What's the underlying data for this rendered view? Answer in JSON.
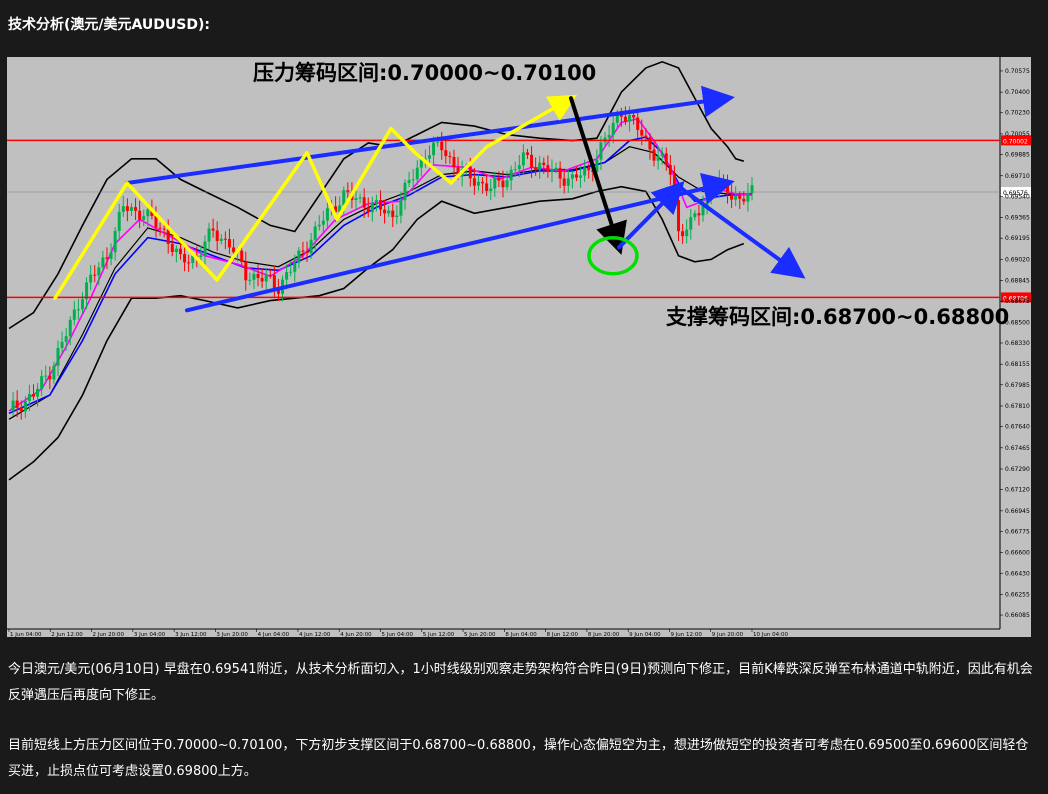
{
  "heading": "技术分析(澳元/美元AUDUSD):",
  "paragraphs": [
    "今日澳元/美元(06月10日) 早盘在0.69541附近，从技术分析面切入，1小时线级别观察走势架构符合昨日(9日)预测向下修正，目前K棒跌深反弹至布林通道中轨附近，因此有机会反弹遇压后再度向下修正。",
    "目前短线上方压力区间位于0.70000~0.70100，下方初步支撑区间于0.68700~0.68800，操作心态偏短空为主，想进场做短空的投资者可考虑在0.69500至0.69600区间轻仓买进，止损点位可考虑设置0.69800上方。"
  ],
  "chart_data": {
    "type": "candlestick",
    "title": "",
    "annotations": {
      "resistance": "压力筹码区间:0.70000~0.70100",
      "support": "支撑筹码区间:0.68700~0.68800"
    },
    "ylim": [
      0.6597,
      0.7069
    ],
    "y_ticks": [
      "0.70575",
      "0.70400",
      "0.70230",
      "0.70055",
      "0.69885",
      "0.69710",
      "0.69540",
      "0.69365",
      "0.69195",
      "0.69020",
      "0.68845",
      "0.68675",
      "0.68500",
      "0.68330",
      "0.68155",
      "0.67985",
      "0.67810",
      "0.67640",
      "0.67465",
      "0.67290",
      "0.67120",
      "0.66945",
      "0.66775",
      "0.66600",
      "0.66430",
      "0.66255",
      "0.66085"
    ],
    "x_ticks": [
      "1 Jun 04:00",
      "2 Jun 12:00",
      "2 Jun 20:00",
      "3 Jun 04:00",
      "3 Jun 12:00",
      "3 Jun 20:00",
      "4 Jun 04:00",
      "4 Jun 12:00",
      "4 Jun 20:00",
      "5 Jun 04:00",
      "5 Jun 12:00",
      "5 Jun 20:00",
      "8 Jun 04:00",
      "8 Jun 12:00",
      "8 Jun 20:00",
      "9 Jun 04:00",
      "9 Jun 12:00",
      "9 Jun 20:00",
      "10 Jun 04:00"
    ],
    "horizontal_lines": [
      {
        "value": 0.70002,
        "label": "0.70002",
        "color": "#ff0000"
      },
      {
        "value": 0.68706,
        "label": "0.68706",
        "color": "#ff0000"
      }
    ],
    "current_price": {
      "value": 0.69576,
      "label": "0.69576"
    },
    "colors": {
      "up": "#00b050",
      "down": "#ff0000",
      "ma_fast": "#ff00ff",
      "ma_slow": "#0000ff",
      "bands": "#000000",
      "channel": "#1a2cff",
      "zigzag": "#ffff00",
      "highlight": "#00e000"
    },
    "close_path": [
      [
        0,
        0.6777
      ],
      [
        6,
        0.679
      ],
      [
        10,
        0.681
      ],
      [
        14,
        0.684
      ],
      [
        18,
        0.6875
      ],
      [
        24,
        0.6905
      ],
      [
        28,
        0.6945
      ],
      [
        33,
        0.694
      ],
      [
        38,
        0.6925
      ],
      [
        42,
        0.69
      ],
      [
        46,
        0.6905
      ],
      [
        50,
        0.6925
      ],
      [
        54,
        0.6915
      ],
      [
        58,
        0.689
      ],
      [
        63,
        0.6885
      ],
      [
        66,
        0.688
      ],
      [
        70,
        0.6898
      ],
      [
        74,
        0.692
      ],
      [
        78,
        0.694
      ],
      [
        82,
        0.6955
      ],
      [
        86,
        0.695
      ],
      [
        90,
        0.6945
      ],
      [
        94,
        0.6938
      ],
      [
        98,
        0.6965
      ],
      [
        102,
        0.699
      ],
      [
        106,
        0.6995
      ],
      [
        110,
        0.6975
      ],
      [
        114,
        0.6968
      ],
      [
        118,
        0.696
      ],
      [
        122,
        0.697
      ],
      [
        126,
        0.6985
      ],
      [
        130,
        0.698
      ],
      [
        134,
        0.6972
      ],
      [
        138,
        0.6968
      ],
      [
        142,
        0.6975
      ],
      [
        146,
        0.7
      ],
      [
        150,
        0.7025
      ],
      [
        154,
        0.701
      ],
      [
        158,
        0.699
      ],
      [
        162,
        0.6975
      ],
      [
        164,
        0.6925
      ],
      [
        167,
        0.693
      ],
      [
        170,
        0.6948
      ],
      [
        173,
        0.6965
      ],
      [
        176,
        0.6958
      ],
      [
        179,
        0.6952
      ],
      [
        182,
        0.6956
      ]
    ],
    "ma_fast": [
      [
        0,
        0.6777
      ],
      [
        8,
        0.6795
      ],
      [
        14,
        0.683
      ],
      [
        20,
        0.687
      ],
      [
        26,
        0.6915
      ],
      [
        32,
        0.6935
      ],
      [
        40,
        0.692
      ],
      [
        48,
        0.6905
      ],
      [
        56,
        0.6898
      ],
      [
        64,
        0.6888
      ],
      [
        72,
        0.6905
      ],
      [
        80,
        0.6935
      ],
      [
        88,
        0.6948
      ],
      [
        96,
        0.695
      ],
      [
        104,
        0.698
      ],
      [
        112,
        0.6978
      ],
      [
        120,
        0.6968
      ],
      [
        128,
        0.6978
      ],
      [
        136,
        0.6975
      ],
      [
        144,
        0.6985
      ],
      [
        150,
        0.7015
      ],
      [
        154,
        0.7018
      ],
      [
        158,
        0.7
      ],
      [
        162,
        0.6978
      ],
      [
        166,
        0.6945
      ],
      [
        170,
        0.695
      ],
      [
        174,
        0.696
      ],
      [
        178,
        0.6956
      ],
      [
        182,
        0.6955
      ]
    ],
    "ma_slow": [
      [
        0,
        0.6775
      ],
      [
        10,
        0.679
      ],
      [
        18,
        0.6835
      ],
      [
        26,
        0.689
      ],
      [
        34,
        0.692
      ],
      [
        42,
        0.6915
      ],
      [
        50,
        0.6905
      ],
      [
        58,
        0.6895
      ],
      [
        66,
        0.6893
      ],
      [
        74,
        0.6905
      ],
      [
        82,
        0.693
      ],
      [
        90,
        0.6945
      ],
      [
        98,
        0.6955
      ],
      [
        106,
        0.697
      ],
      [
        114,
        0.6972
      ],
      [
        122,
        0.697
      ],
      [
        130,
        0.6975
      ],
      [
        138,
        0.6975
      ],
      [
        146,
        0.6982
      ],
      [
        152,
        0.7
      ],
      [
        156,
        0.7003
      ],
      [
        160,
        0.699
      ],
      [
        164,
        0.6965
      ],
      [
        168,
        0.695
      ],
      [
        172,
        0.6953
      ],
      [
        176,
        0.6955
      ],
      [
        182,
        0.6956
      ]
    ],
    "bb_upper": [
      [
        0,
        0.6845
      ],
      [
        6,
        0.6858
      ],
      [
        12,
        0.689
      ],
      [
        18,
        0.693
      ],
      [
        24,
        0.6968
      ],
      [
        30,
        0.6985
      ],
      [
        36,
        0.6985
      ],
      [
        42,
        0.6968
      ],
      [
        48,
        0.6958
      ],
      [
        56,
        0.6945
      ],
      [
        64,
        0.693
      ],
      [
        70,
        0.6925
      ],
      [
        76,
        0.6955
      ],
      [
        82,
        0.6985
      ],
      [
        88,
        0.6998
      ],
      [
        94,
        0.6995
      ],
      [
        100,
        0.7005
      ],
      [
        106,
        0.7015
      ],
      [
        114,
        0.7012
      ],
      [
        122,
        0.7005
      ],
      [
        130,
        0.7002
      ],
      [
        138,
        0.7
      ],
      [
        144,
        0.7002
      ],
      [
        150,
        0.704
      ],
      [
        156,
        0.706
      ],
      [
        160,
        0.7065
      ],
      [
        164,
        0.706
      ],
      [
        168,
        0.7035
      ],
      [
        172,
        0.701
      ],
      [
        176,
        0.6995
      ],
      [
        178,
        0.6985
      ],
      [
        180,
        0.6983
      ]
    ],
    "bb_lower": [
      [
        0,
        0.672
      ],
      [
        6,
        0.6735
      ],
      [
        12,
        0.6755
      ],
      [
        18,
        0.679
      ],
      [
        24,
        0.6835
      ],
      [
        30,
        0.687
      ],
      [
        36,
        0.687
      ],
      [
        42,
        0.6872
      ],
      [
        48,
        0.6868
      ],
      [
        56,
        0.6862
      ],
      [
        64,
        0.6868
      ],
      [
        70,
        0.687
      ],
      [
        76,
        0.6872
      ],
      [
        82,
        0.6878
      ],
      [
        88,
        0.6895
      ],
      [
        94,
        0.691
      ],
      [
        100,
        0.6935
      ],
      [
        106,
        0.695
      ],
      [
        114,
        0.694
      ],
      [
        122,
        0.6945
      ],
      [
        130,
        0.695
      ],
      [
        138,
        0.6952
      ],
      [
        144,
        0.6958
      ],
      [
        150,
        0.6962
      ],
      [
        156,
        0.6958
      ],
      [
        160,
        0.6935
      ],
      [
        164,
        0.6905
      ],
      [
        168,
        0.69
      ],
      [
        172,
        0.6902
      ],
      [
        176,
        0.691
      ],
      [
        180,
        0.6915
      ]
    ],
    "bb_middle": [
      [
        0,
        0.677
      ],
      [
        10,
        0.679
      ],
      [
        18,
        0.684
      ],
      [
        26,
        0.6895
      ],
      [
        34,
        0.6928
      ],
      [
        42,
        0.692
      ],
      [
        50,
        0.6908
      ],
      [
        58,
        0.69
      ],
      [
        66,
        0.6896
      ],
      [
        74,
        0.691
      ],
      [
        82,
        0.6935
      ],
      [
        90,
        0.6948
      ],
      [
        98,
        0.6958
      ],
      [
        106,
        0.6972
      ],
      [
        114,
        0.6975
      ],
      [
        122,
        0.6972
      ],
      [
        130,
        0.6976
      ],
      [
        138,
        0.6976
      ],
      [
        146,
        0.6982
      ],
      [
        152,
        0.6995
      ],
      [
        158,
        0.699
      ],
      [
        164,
        0.697
      ],
      [
        170,
        0.6958
      ],
      [
        176,
        0.6956
      ],
      [
        180,
        0.6956
      ]
    ],
    "channel_upper": [
      [
        0.2,
        0.6965
      ],
      [
        1.2,
        0.7035
      ]
    ],
    "channel_lower": [
      [
        0.3,
        0.686
      ],
      [
        1.2,
        0.6965
      ]
    ],
    "zigzag": [
      [
        0.08,
        0.687
      ],
      [
        0.2,
        0.6965
      ],
      [
        0.35,
        0.6885
      ],
      [
        0.5,
        0.699
      ],
      [
        0.55,
        0.6935
      ],
      [
        0.64,
        0.701
      ],
      [
        0.68,
        0.699
      ],
      [
        0.74,
        0.6965
      ],
      [
        0.8,
        0.6995
      ],
      [
        0.94,
        0.7035
      ]
    ],
    "arrows": [
      {
        "from": [
          0.94,
          0.7035
        ],
        "to": [
          1.02,
          0.6912
        ],
        "color": "#000000"
      },
      {
        "from": [
          1.02,
          0.6912
        ],
        "to": [
          1.12,
          0.6962
        ],
        "color": "#1a2cff"
      },
      {
        "from": [
          1.12,
          0.6962
        ],
        "to": [
          1.32,
          0.689
        ],
        "color": "#1a2cff"
      }
    ],
    "highlight_circle": {
      "x": 1.01,
      "y": 0.6905
    }
  }
}
